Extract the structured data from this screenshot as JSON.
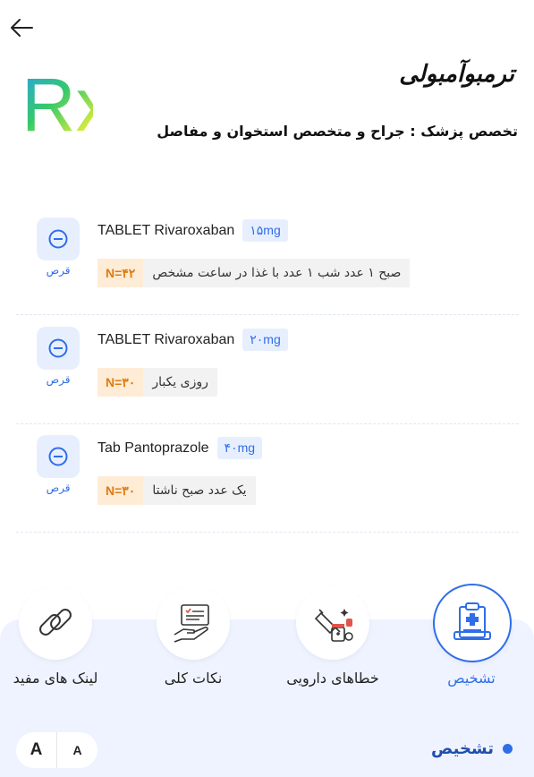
{
  "header": {
    "back_icon": "arrow-left-icon",
    "logo_text": "Rx",
    "doctor_name": "ترمبوآمبولی",
    "specialty": "تخصص پزشک : جراح و متخصص استخوان و مفاصل"
  },
  "prescriptions": [
    {
      "form": "قرص",
      "drug": "TABLET Rivaroxaban",
      "dose": "۱۵mg",
      "count": "N=۴۲",
      "instruction": "صبح ۱ عدد شب ۱ عدد با غذا در ساعت مشخص"
    },
    {
      "form": "قرص",
      "drug": "TABLET Rivaroxaban",
      "dose": "۲۰mg",
      "count": "N=۳۰",
      "instruction": "روزی یکبار"
    },
    {
      "form": "قرص",
      "drug": "Tab Pantoprazole",
      "dose": "۴۰mg",
      "count": "N=۳۰",
      "instruction": "یک عدد صبح ناشتا"
    }
  ],
  "bottom_nav": [
    {
      "label": "تشخیص",
      "icon": "clipboard-medical-icon",
      "active": true
    },
    {
      "label": "خطاهای دارویی",
      "icon": "medicine-bottles-icon",
      "active": false
    },
    {
      "label": "نکات کلی",
      "icon": "hand-card-icon",
      "active": false
    },
    {
      "label": "لینک های مفید",
      "icon": "chain-link-icon",
      "active": false
    }
  ],
  "font_size": {
    "large": "A",
    "small": "A"
  },
  "section_title": "تشخیص",
  "colors": {
    "accent": "#2f6ee8",
    "count_bg": "#ffecd6",
    "count_text": "#e07a10",
    "panel_bg": "#eef3ff"
  }
}
